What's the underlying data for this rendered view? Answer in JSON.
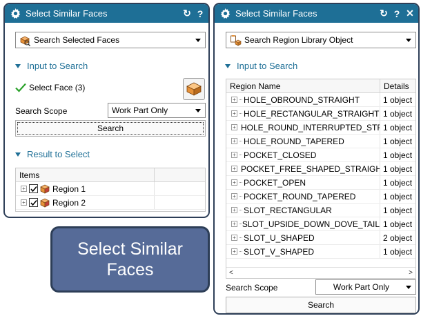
{
  "left_dialog": {
    "title": "Select Similar Faces",
    "reset_glyph": "↻",
    "help_glyph": "?",
    "type_selector": {
      "value": "Search Selected Faces",
      "icon": "selected-faces-icon"
    },
    "input_section": {
      "label": "Input to Search"
    },
    "select_face": {
      "label": "Select Face (3)",
      "status_icon": "checkmark-icon",
      "face_icon": "face-cube-icon"
    },
    "search_scope": {
      "label": "Search Scope",
      "value": "Work Part Only"
    },
    "search_button": "Search",
    "result_section": {
      "label": "Result to Select"
    },
    "items_grid": {
      "header": "Items",
      "rows": [
        {
          "label": "Region 1",
          "checked": true
        },
        {
          "label": "Region 2",
          "checked": true
        }
      ]
    }
  },
  "right_dialog": {
    "title": "Select Similar Faces",
    "reset_glyph": "↻",
    "help_glyph": "?",
    "close_glyph": "✕",
    "type_selector": {
      "value": "Search Region Library Object",
      "icon": "region-library-icon"
    },
    "input_section": {
      "label": "Input to Search"
    },
    "region_grid": {
      "headers": {
        "name": "Region Name",
        "details": "Details"
      },
      "rows": [
        {
          "name": "HOLE_OBROUND_STRAIGHT",
          "details": "1 object"
        },
        {
          "name": "HOLE_RECTANGULAR_STRAIGHT",
          "details": "1 object"
        },
        {
          "name": "HOLE_ROUND_INTERRUPTED_STRA...",
          "details": "1 object"
        },
        {
          "name": "HOLE_ROUND_TAPERED",
          "details": "1 object"
        },
        {
          "name": "POCKET_CLOSED",
          "details": "1 object"
        },
        {
          "name": "POCKET_FREE_SHAPED_STRAIGHT",
          "details": "1 object"
        },
        {
          "name": "POCKET_OPEN",
          "details": "1 object"
        },
        {
          "name": "POCKET_ROUND_TAPERED",
          "details": "1 object"
        },
        {
          "name": "SLOT_RECTANGULAR",
          "details": "1 object"
        },
        {
          "name": "SLOT_UPSIDE_DOWN_DOVE_TAIL",
          "details": "1 object"
        },
        {
          "name": "SLOT_U_SHAPED",
          "details": "2 object"
        },
        {
          "name": "SLOT_V_SHAPED",
          "details": "1 object"
        }
      ],
      "scroll_left_glyph": "<",
      "scroll_right_glyph": ">"
    },
    "search_scope": {
      "label": "Search Scope",
      "value": "Work Part Only"
    },
    "search_button": "Search"
  },
  "caption": {
    "line1": "Select Similar",
    "line2": "Faces"
  },
  "colors": {
    "title_bar": "#1e6f96",
    "section_text": "#1e6f96",
    "frame": "#2d3e57",
    "caption_bg": "#566b98",
    "check_green": "#2aa12a"
  }
}
